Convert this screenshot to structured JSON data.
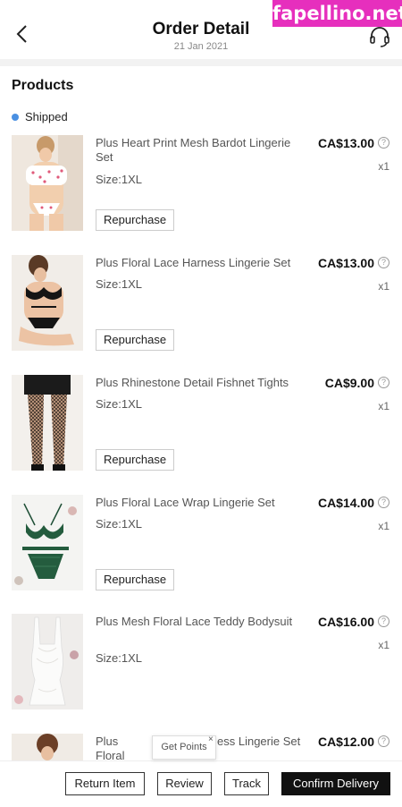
{
  "header": {
    "title": "Order Detail",
    "date": "21 Jan 2021"
  },
  "watermark": "fapellino.net",
  "products": {
    "heading": "Products",
    "status": "Shipped",
    "status_color": "#4a90e2"
  },
  "items": [
    {
      "name": "Plus Heart Print Mesh Bardot Lingerie Set",
      "size": "Size:1XL",
      "price": "CA$13.00",
      "qty": "x1",
      "repurchase": "Repurchase",
      "thumb": "white-pink-heart-lingerie"
    },
    {
      "name": "Plus Floral Lace Harness Lingerie Set",
      "size": "Size:1XL",
      "price": "CA$13.00",
      "qty": "x1",
      "repurchase": "Repurchase",
      "thumb": "black-lace-harness-lingerie"
    },
    {
      "name": "Plus Rhinestone Detail Fishnet Tights",
      "size": "Size:1XL",
      "price": "CA$9.00",
      "qty": "x1",
      "repurchase": "Repurchase",
      "thumb": "black-fishnet-tights"
    },
    {
      "name": "Plus Floral Lace Wrap Lingerie Set",
      "size": "Size:1XL",
      "price": "CA$14.00",
      "qty": "x1",
      "repurchase": "Repurchase",
      "thumb": "green-lace-lingerie"
    },
    {
      "name": "Plus Mesh Floral Lace Teddy Bodysuit",
      "size": "Size:1XL",
      "price": "CA$16.00",
      "qty": "x1",
      "thumb": "white-lace-teddy"
    },
    {
      "name": "Plus Floral",
      "name_tail": "ess Lingerie Set",
      "price": "CA$12.00",
      "thumb": "lingerie-model"
    }
  ],
  "tooltip": {
    "label": "Get Points",
    "close": "×"
  },
  "actions": {
    "return_item": "Return Item",
    "review": "Review",
    "track": "Track",
    "confirm_delivery": "Confirm Delivery"
  },
  "info_glyph": "?"
}
